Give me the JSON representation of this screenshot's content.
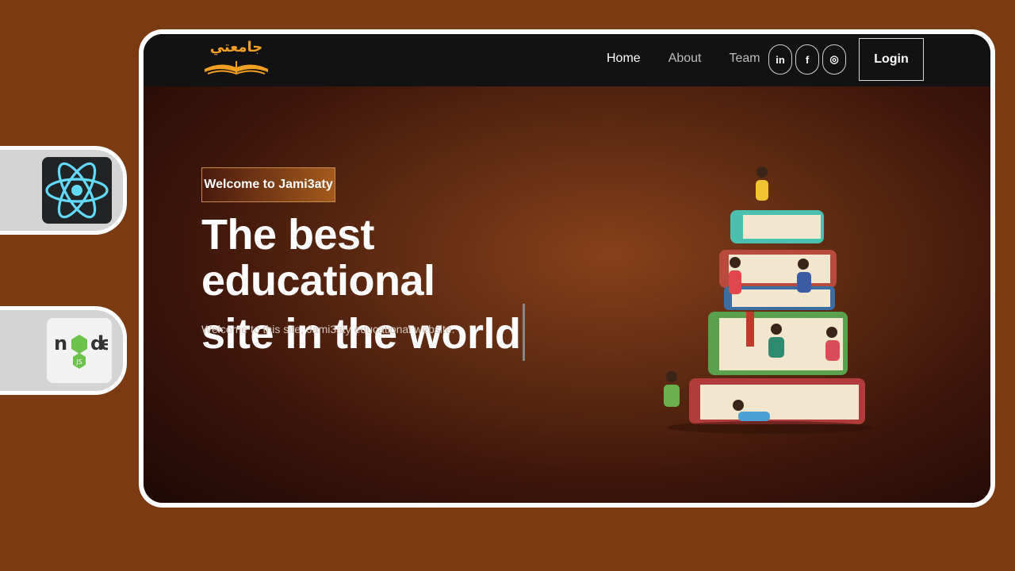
{
  "logo": {
    "text": "جامعتي"
  },
  "nav": {
    "links": [
      {
        "label": "Home",
        "active": true
      },
      {
        "label": "About",
        "active": false
      },
      {
        "label": "Team",
        "active": false
      }
    ],
    "socials": [
      {
        "icon": "linkedin-icon",
        "glyph": "in"
      },
      {
        "icon": "facebook-icon",
        "glyph": "f"
      },
      {
        "icon": "instagram-icon",
        "glyph": "◎"
      }
    ],
    "login_label": "Login"
  },
  "hero": {
    "tag": "Welcome to Jami3aty",
    "title_line1": "The best educational",
    "title_line2": "site in the world",
    "subtitle": "Welcome to this site, Jami3aty educational website."
  },
  "side_badges": [
    {
      "icon": "react-logo-icon"
    },
    {
      "icon": "nodejs-logo-icon"
    }
  ],
  "colors": {
    "background": "#7b3a11",
    "navbar": "#121212",
    "logo_accent": "#f2a024"
  }
}
